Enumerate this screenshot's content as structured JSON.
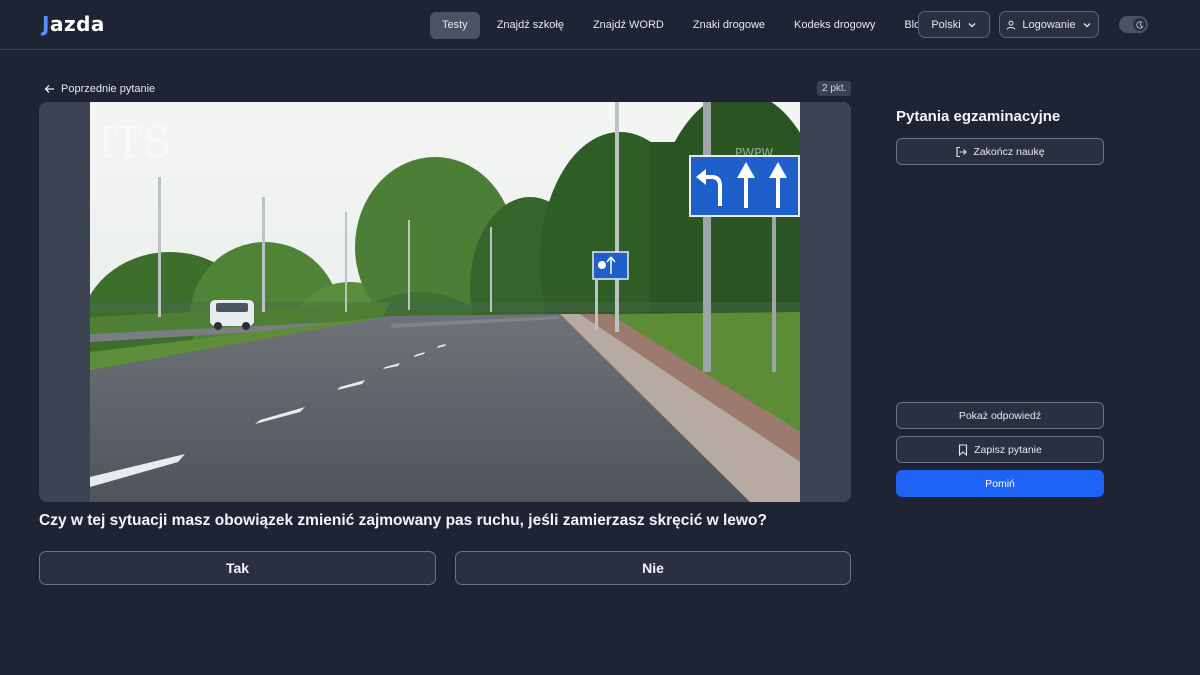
{
  "app": {
    "logo_text": "jazda"
  },
  "nav": {
    "items": [
      "Testy",
      "Znajdź szkołę",
      "Znajdź WORD",
      "Znaki drogowe",
      "Kodeks drogowy",
      "Blog"
    ],
    "active_index": 0
  },
  "header": {
    "language": "Polski",
    "login": "Logowanie"
  },
  "question": {
    "back_label": "Poprzednie pytanie",
    "points": "2 pkt.",
    "text": "Czy w tej sytuacji masz obowiązek zmienić zajmowany pas ruchu, jeśli zamierzasz skręcić w lewo?",
    "answers": [
      "Tak",
      "Nie"
    ],
    "watermark": "PWPW"
  },
  "sidebar": {
    "title": "Pytania egzaminacyjne",
    "end_label": "Zakończ naukę",
    "show_answer_label": "Pokaż odpowiedź",
    "save_label": "Zapisz pytanie",
    "skip_label": "Pomiń"
  },
  "colors": {
    "accent": "#1d63f5",
    "background": "#1e2433",
    "sign_blue": "#1e5fc9"
  }
}
